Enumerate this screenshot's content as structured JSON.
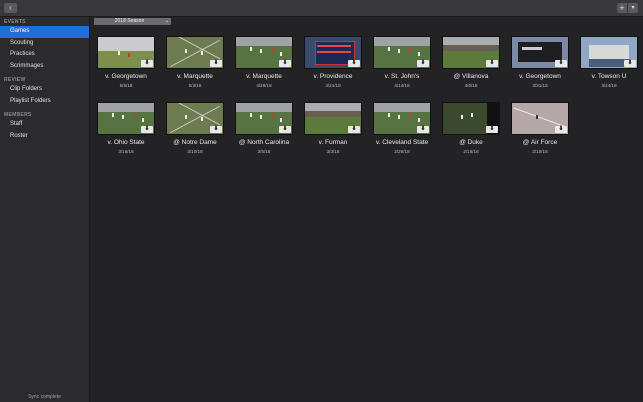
{
  "titlebar": {
    "back_glyph": "‹",
    "add_glyph": "+",
    "add_menu_glyph": "▾"
  },
  "sidebar": {
    "sections": [
      {
        "header": "EVENTS",
        "items": [
          {
            "label": "Games",
            "active": true
          },
          {
            "label": "Scouting"
          },
          {
            "label": "Practices"
          },
          {
            "label": "Scrimmages"
          }
        ]
      },
      {
        "header": "REVIEW",
        "items": [
          {
            "label": "Clip Folders"
          },
          {
            "label": "Playlist Folders"
          }
        ]
      },
      {
        "header": "MEMBERS",
        "items": [
          {
            "label": "Staff"
          },
          {
            "label": "Roster"
          }
        ]
      }
    ],
    "status": "Sync complete"
  },
  "season_select": {
    "value": "2018 Season",
    "chevron": "⌄"
  },
  "games": [
    {
      "title": "v. Georgetown",
      "date": "5/5/18",
      "thumb": "broadcast"
    },
    {
      "title": "v. Marquette",
      "date": "5/3/18",
      "thumb": "field-lines"
    },
    {
      "title": "v. Marquette",
      "date": "4/28/18",
      "thumb": "players"
    },
    {
      "title": "v. Providence",
      "date": "4/21/18",
      "thumb": "scoreboard"
    },
    {
      "title": "v. St. John's",
      "date": "4/14/18",
      "thumb": "players"
    },
    {
      "title": "@ Villanova",
      "date": "4/6/18",
      "thumb": "stadium"
    },
    {
      "title": "v. Georgetown",
      "date": "3/31/18",
      "thumb": "scoreboard-dark"
    },
    {
      "title": "v. Towson U",
      "date": "3/24/18",
      "thumb": "sign"
    },
    {
      "title": "v. Ohio State",
      "date": "3/16/18",
      "thumb": "players"
    },
    {
      "title": "@ Notre Dame",
      "date": "3/10/18",
      "thumb": "field-lines"
    },
    {
      "title": "@ North Carolina",
      "date": "3/5/18",
      "thumb": "players"
    },
    {
      "title": "v. Furman",
      "date": "3/3/18",
      "thumb": "stadium"
    },
    {
      "title": "v. Cleveland State",
      "date": "2/26/18",
      "thumb": "players"
    },
    {
      "title": "@ Duke",
      "date": "2/16/18",
      "thumb": "field-dark"
    },
    {
      "title": "@ Air Force",
      "date": "2/10/18",
      "thumb": "snow"
    }
  ],
  "download_glyph": "⬇"
}
